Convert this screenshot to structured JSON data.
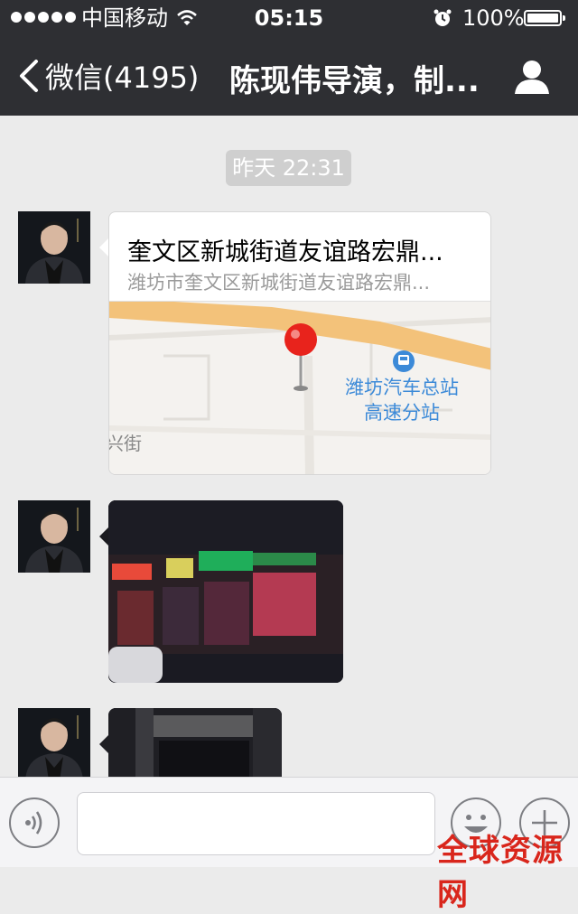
{
  "status_bar": {
    "carrier": "中国移动",
    "time": "05:15",
    "battery": "100%"
  },
  "nav": {
    "back_label": "微信(4195)",
    "title": "陈现伟导演，制..."
  },
  "chat": {
    "timestamp": "昨天 22:31",
    "messages": [
      {
        "type": "location",
        "name": "奎文区新城街道友谊路宏鼎...",
        "address": "潍坊市奎文区新城街道友谊路宏鼎...",
        "map_labels": {
          "station_line1": "潍坊汽车总站",
          "station_line2": "高速分站",
          "street_fragment": "兴街"
        }
      },
      {
        "type": "image",
        "description_icon": "photo"
      },
      {
        "type": "image",
        "description_icon": "photo"
      }
    ]
  },
  "watermark": "全球资源网",
  "colors": {
    "header_bg": "#2e2f33",
    "chat_bg": "#ebebeb",
    "pin_red": "#e8231c",
    "station_blue": "#3c8ad8",
    "watermark_red": "#d9261c"
  },
  "icons": {
    "back": "chevron-left-icon",
    "profile": "person-icon",
    "voice": "voice-icon",
    "emoji": "emoji-icon",
    "plus": "plus-icon",
    "wifi": "wifi-icon",
    "alarm": "alarm-icon",
    "battery": "battery-icon"
  }
}
